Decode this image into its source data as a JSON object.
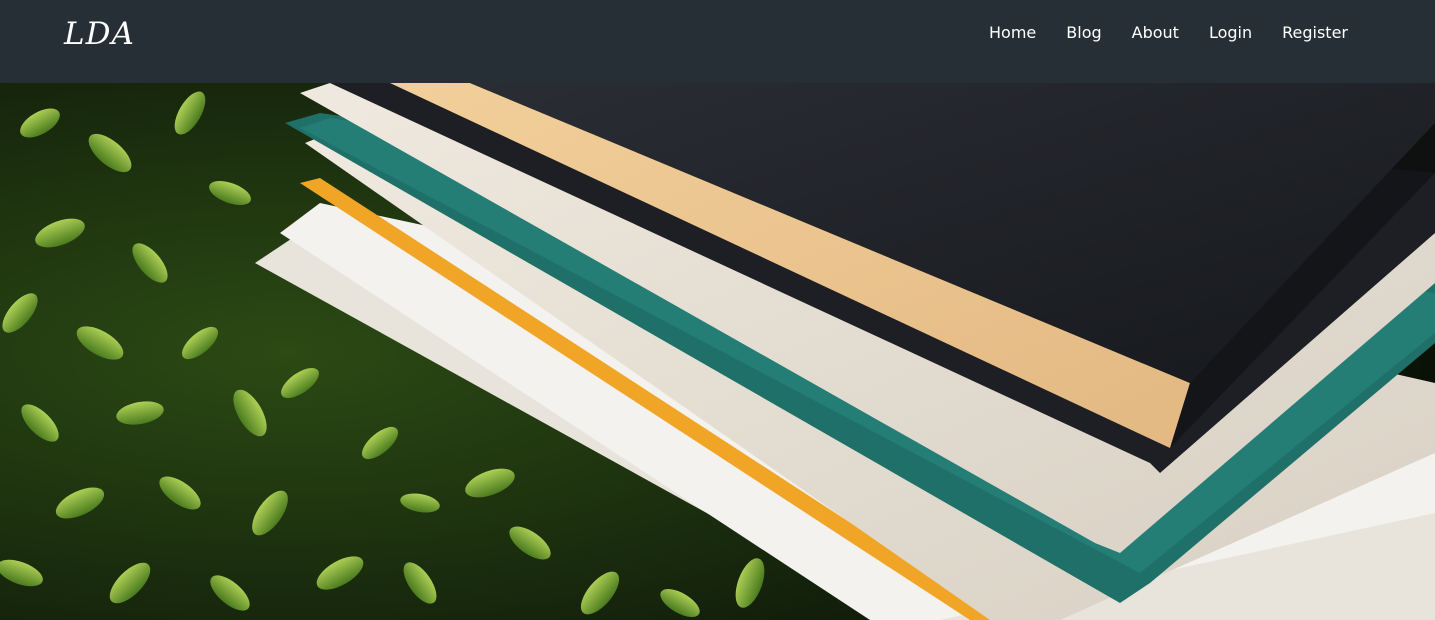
{
  "header": {
    "brand": "LDA",
    "nav": [
      {
        "label": "Home"
      },
      {
        "label": "Blog"
      },
      {
        "label": "About"
      },
      {
        "label": "Login"
      },
      {
        "label": "Register"
      }
    ]
  },
  "hero": {
    "image": "stack-of-books-on-grass-photo"
  },
  "colors": {
    "navbar_bg": "#252f35",
    "nav_text": "#ffffff"
  }
}
